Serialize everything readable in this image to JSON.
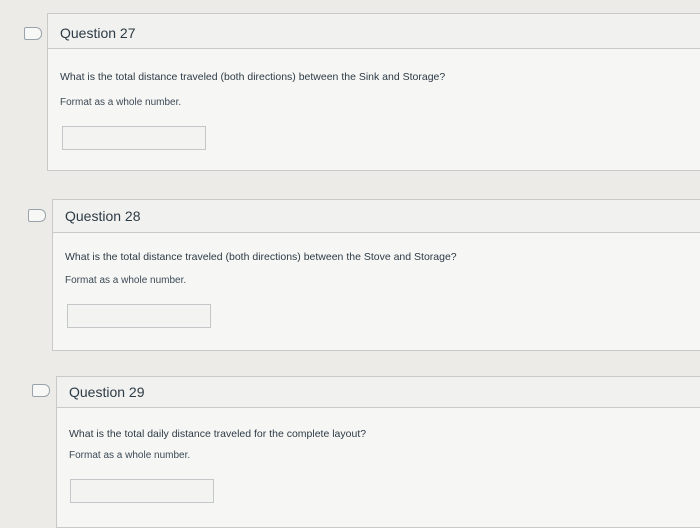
{
  "questions": [
    {
      "title": "Question 27",
      "prompt": "What is the total distance traveled (both directions) between the Sink and Storage?",
      "hint": "Format as a whole number.",
      "answer_value": ""
    },
    {
      "title": "Question 28",
      "prompt": "What is the total distance traveled (both directions) between the Stove and Storage?",
      "hint": "Format as a whole number.",
      "answer_value": ""
    },
    {
      "title": "Question 29",
      "prompt": "What is the total daily distance traveled for the complete layout?",
      "hint": "Format as a whole number.",
      "answer_value": ""
    }
  ],
  "icons": {
    "flag": "flag-bookmark-icon"
  },
  "colors": {
    "card_bg": "#f6f6f5",
    "header_bg": "#f1f1ef",
    "border": "#c9c9c6",
    "text": "#2d3b45"
  }
}
